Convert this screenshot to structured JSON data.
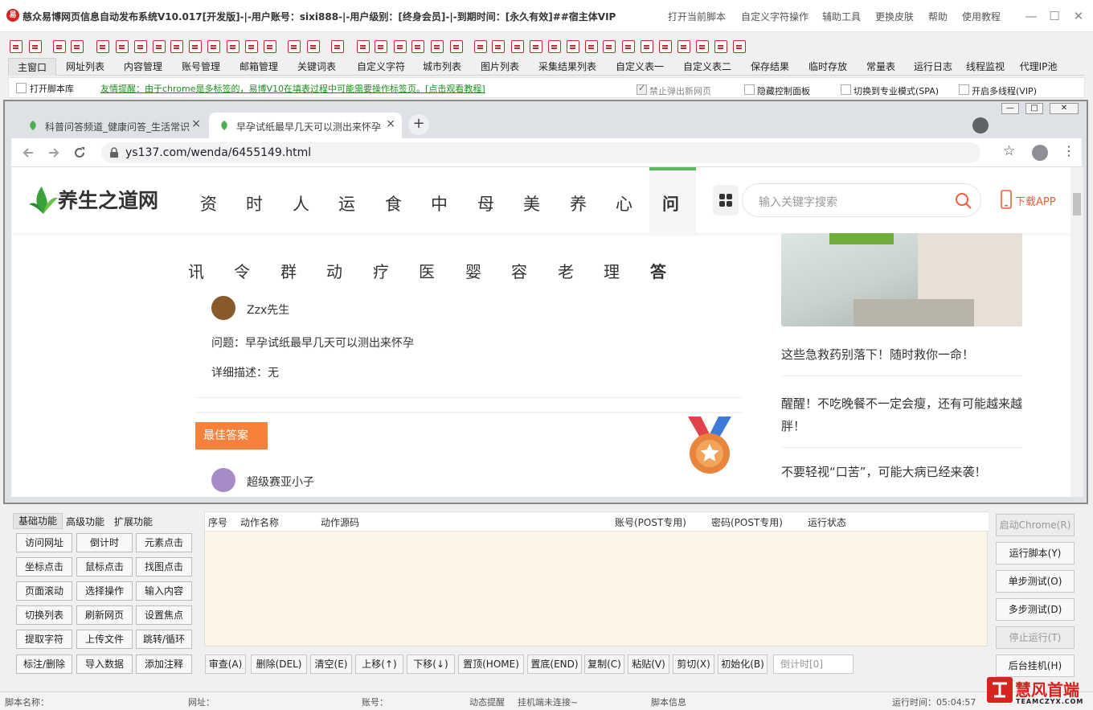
{
  "app": {
    "title": "慈众易博网页信息自动发布系统V10.017[开发版]-|-用户账号：sixi888-|-用户级别：[终身会员]-|-到期时间：[永久有效]##宿主体VIP",
    "logo_text": "易",
    "menu": [
      "打开当前脚本",
      "自定义字符操作",
      "辅助工具",
      "更换皮肤",
      "帮助",
      "使用教程"
    ],
    "window_controls": [
      "—",
      "☐",
      "✕"
    ]
  },
  "tabs": [
    "主窗口",
    "网址列表",
    "内容管理",
    "账号管理",
    "邮箱管理",
    "关键词表",
    "自定义字符",
    "城市列表",
    "图片列表",
    "采集结果列表",
    "自定义表一",
    "自定义表二",
    "保存结果",
    "临时存放",
    "常量表",
    "运行日志",
    "线程监视",
    "代理IP池"
  ],
  "options": {
    "open_script_lib": "打开脚本库",
    "tip": "友情提醒：由于chrome是多标签的，易博V10在填表过程中可能需要操作标签页。[点击观看教程]",
    "block_popup": "禁止弹出新网页",
    "hide_panel": "隐藏控制面板",
    "spa_mode": "切换到专业模式(SPA)",
    "multi_thread": "开启多线程(VIP)"
  },
  "browser": {
    "tabs": [
      {
        "title": "科普问答频道_健康问答_生活常识",
        "close": "×"
      },
      {
        "title": "早孕试纸最早几天可以测出来怀孕",
        "close": "×"
      }
    ],
    "new_tab": "+",
    "url": "ys137.com/wenda/6455149.html",
    "inner_window_controls": [
      "—",
      "□",
      "✕"
    ]
  },
  "site": {
    "logo": "养生之道网",
    "nav_row1": [
      "资",
      "时",
      "人",
      "运",
      "食",
      "中",
      "母",
      "美",
      "养",
      "心",
      "问"
    ],
    "nav_row2": [
      "讯",
      "令",
      "群",
      "动",
      "疗",
      "医",
      "婴",
      "容",
      "老",
      "理",
      "答"
    ],
    "search_placeholder": "输入关键字搜索",
    "download_app": "下载APP",
    "question_user": "Zzx先生",
    "question": "问题：早孕试纸最早几天可以测出来怀孕",
    "detail": "详细描述：无",
    "best_answer": "最佳答案",
    "answer_user": "超级赛亚小子",
    "side_links": [
      "这些急救药别落下！随时救你一命！",
      "醒醒！不吃晚餐不一定会瘦，还有可能越来越胖！",
      "不要轻视“口苦”，可能大病已经来袭！"
    ]
  },
  "func_tabs": [
    "基础功能",
    "高级功能",
    "扩展功能"
  ],
  "func_buttons": [
    "访问网址",
    "倒计时",
    "元素点击",
    "坐标点击",
    "鼠标点击",
    "找图点击",
    "页面滚动",
    "选择操作",
    "输入内容",
    "切换列表",
    "刷新网页",
    "设置焦点",
    "提取字符",
    "上传文件",
    "跳转/循环",
    "标注/删除",
    "导入数据",
    "添加注释"
  ],
  "table_headers": [
    "序号",
    "动作名称",
    "动作源码",
    "账号(POST专用)",
    "密码(POST专用)",
    "运行状态"
  ],
  "action_buttons": [
    "审查(A)",
    "删除(DEL)",
    "清空(E)",
    "上移(↑)",
    "下移(↓)",
    "置顶(HOME)",
    "置底(END)",
    "复制(C)",
    "粘贴(V)",
    "剪切(X)",
    "初始化(B)"
  ],
  "countdown": "倒计时[0]",
  "right_buttons": [
    "启动Chrome(R)",
    "运行脚本(Y)",
    "单步测试(O)",
    "多步测试(D)",
    "停止运行(T)",
    "后台挂机(H)"
  ],
  "status": {
    "script_name": "脚本名称：",
    "url": "网址：",
    "account": "账号：",
    "dynamic": "动态提醒",
    "hang": "挂机端未连接~",
    "script_info": "脚本信息",
    "run_time": "运行时间：05:04:57"
  },
  "watermark": {
    "brand": "慧风首端",
    "domain": "TEAMCZYX.COM"
  },
  "colors": {
    "accent_red": "#d6231f",
    "best_answer_bg": "#f5813b",
    "site_green": "#5cb85c",
    "table_bg": "#fdf5e6"
  }
}
